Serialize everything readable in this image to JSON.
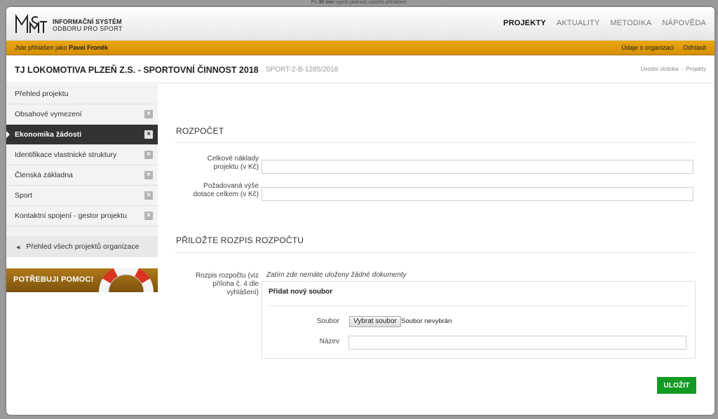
{
  "top_note": {
    "prefix": "Po",
    "bold": "30 min",
    "suffix": "vyprší platnost vašeho přihlášení"
  },
  "header": {
    "logo_line1": "INFORMAČNÍ SYSTÉM",
    "logo_line2": "ODBORU PRO SPORT",
    "menu": [
      "PROJEKTY",
      "AKTUALITY",
      "METODIKA",
      "NÁPOVĚDA"
    ],
    "active_menu": "PROJEKTY"
  },
  "userbar": {
    "logged_prefix": "Jste přihlášen jako",
    "user_name": "Pavel Froněk",
    "links": [
      "Údaje o organizaci",
      "Odhlásit"
    ]
  },
  "project": {
    "title": "TJ LOKOMOTIVA PLZEŇ Z.S. - SPORTOVNÍ ČINNOST 2018",
    "code": "SPORT-2-B-1285/2018",
    "breadcrumb": [
      "Úvodní stránka",
      "Projekty"
    ]
  },
  "sidebar": {
    "items": [
      {
        "label": "Přehled projektu"
      },
      {
        "label": "Obsahové vymezení"
      },
      {
        "label": "Ekonomika žádosti"
      },
      {
        "label": "Identifikace vlastnické struktury"
      },
      {
        "label": "Členská základna"
      },
      {
        "label": "Sport"
      },
      {
        "label": "Kontaktní spojení - gestor projektu"
      }
    ],
    "active_index": 2,
    "back_link": "Přehled všech projektů organizace",
    "help_label": "POTŘEBUJI POMOC!"
  },
  "form": {
    "section1_title": "ROZPOČET",
    "total_cost_label_1": "Celkové náklady",
    "total_cost_label_2": "projektu (v Kč)",
    "total_cost_value": "",
    "subsidy_label_1": "Požadovaná výše",
    "subsidy_label_2": "dotace celkem (v Kč)",
    "subsidy_value": "",
    "section2_title": "PŘILOŽTE ROZPIS ROZPOČTU",
    "budget_label_1": "Rozpis rozpočtu (viz",
    "budget_label_2": "příloha č. 4 dle",
    "budget_label_3": "vyhlášení)",
    "no_docs": "Zatím zde nemáte uloženy žádné dokumenty",
    "upload_title": "Přidat nový soubor",
    "file_label": "Soubor",
    "file_button": "Vybrat soubor",
    "file_status": "Soubor nevybrán",
    "name_label": "Název",
    "name_value": "",
    "save_button": "ULOŽIT"
  },
  "colors": {
    "accent": "#d99400",
    "save": "#139a22",
    "active_nav": "#333333"
  }
}
